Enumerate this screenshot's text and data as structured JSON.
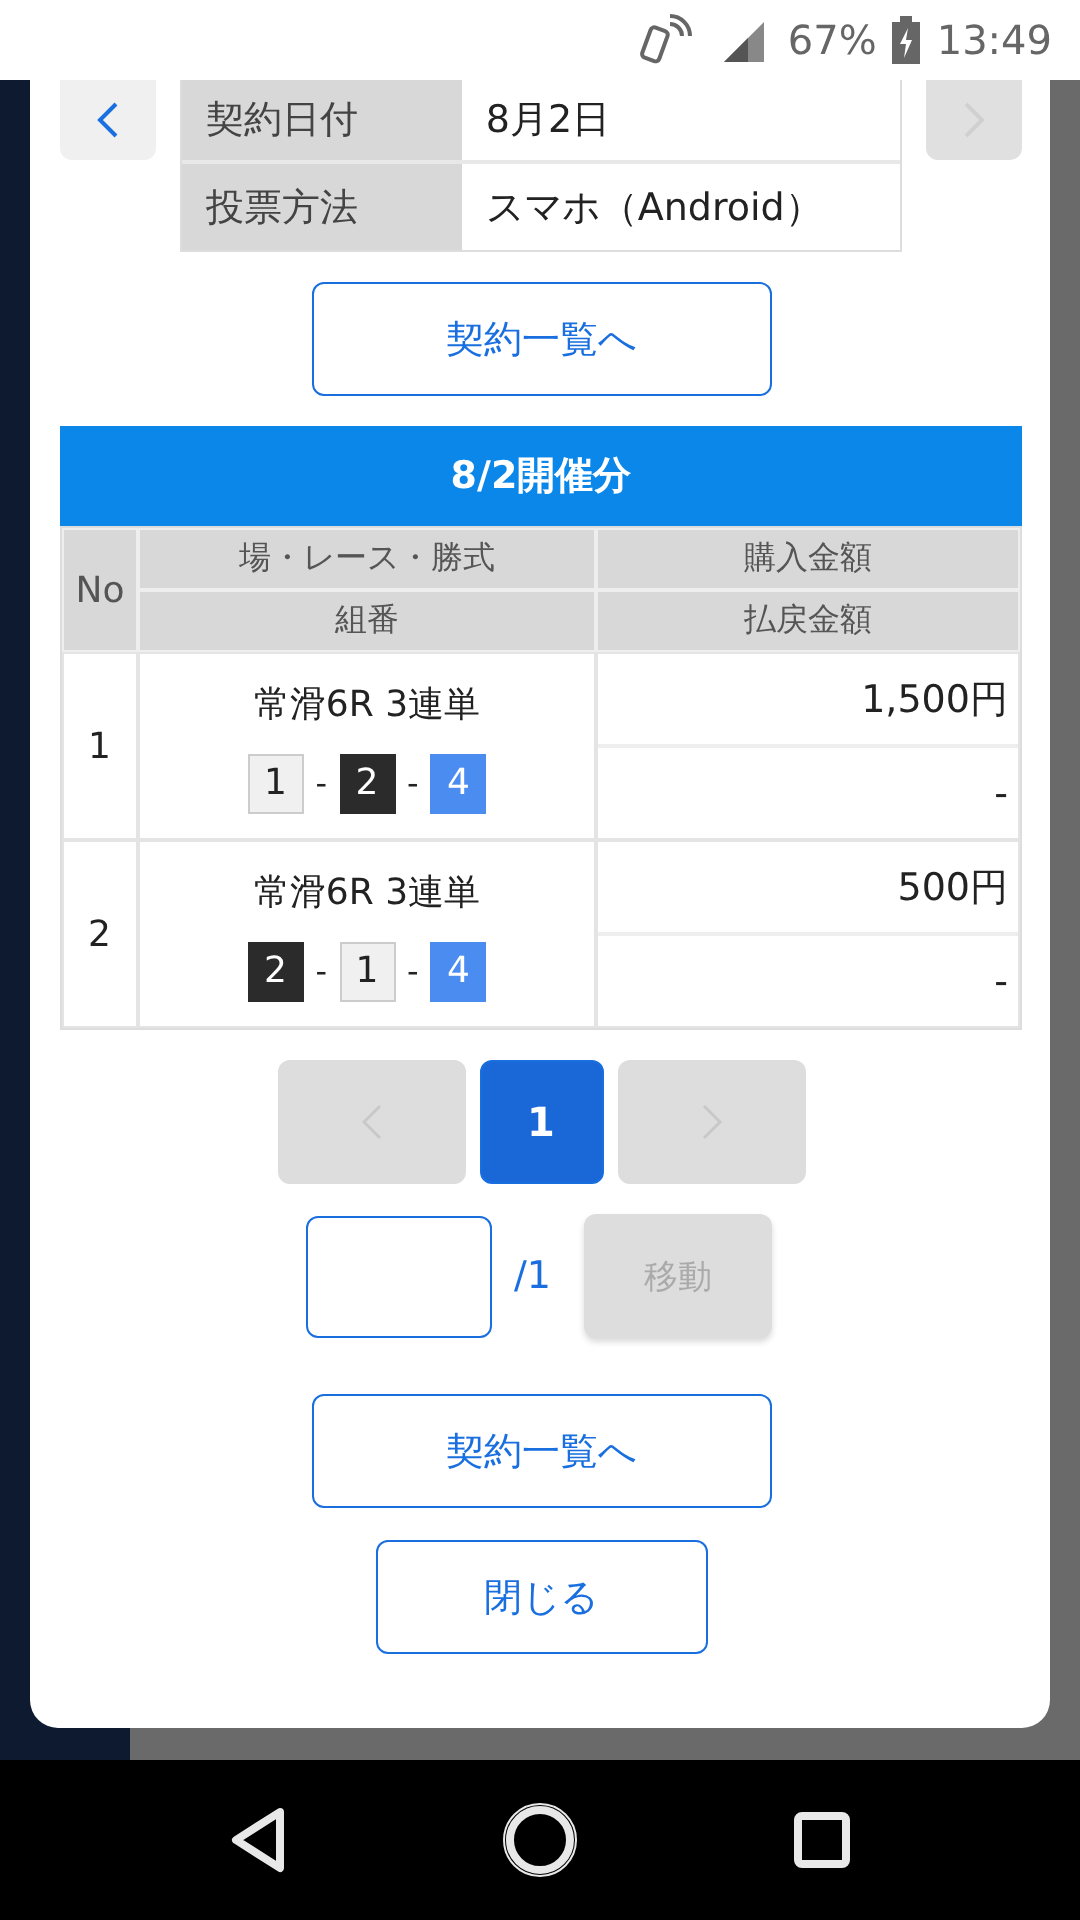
{
  "status_bar": {
    "battery": "67%",
    "time": "13:49"
  },
  "record_nav": {
    "prev_disabled": false,
    "next_disabled": true
  },
  "contract_info": [
    {
      "label": "契約日付",
      "value": "8月2日"
    },
    {
      "label": "投票方法",
      "value": "スマホ（Android）"
    }
  ],
  "top_button": "契約一覧へ",
  "section_title": "8/2開催分",
  "table": {
    "no_header": "No",
    "col1_top": "場・レース・勝式",
    "col1_bottom": "組番",
    "col2_top": "購入金額",
    "col2_bottom": "払戻金額",
    "rows": [
      {
        "no": "1",
        "race": "常滑6R 3連単",
        "combination": [
          {
            "number": "1",
            "color": "#f0f0f0"
          },
          {
            "number": "2",
            "color": "#2b2b2b"
          },
          {
            "number": "4",
            "color": "#4a8cf0"
          }
        ],
        "separator": "-",
        "purchase": "1,500円",
        "payout": "-"
      },
      {
        "no": "2",
        "race": "常滑6R 3連単",
        "combination": [
          {
            "number": "2",
            "color": "#2b2b2b"
          },
          {
            "number": "1",
            "color": "#f0f0f0"
          },
          {
            "number": "4",
            "color": "#4a8cf0"
          }
        ],
        "separator": "-",
        "purchase": "500円",
        "payout": "-"
      }
    ]
  },
  "pagination": {
    "prev_disabled": true,
    "pages": [
      {
        "label": "1",
        "selected": true
      }
    ],
    "next_disabled": true
  },
  "page_jump": {
    "total": "/1",
    "button": "移動",
    "button_disabled": true
  },
  "bottom_buttons": [
    "契約一覧へ",
    "閉じる"
  ]
}
